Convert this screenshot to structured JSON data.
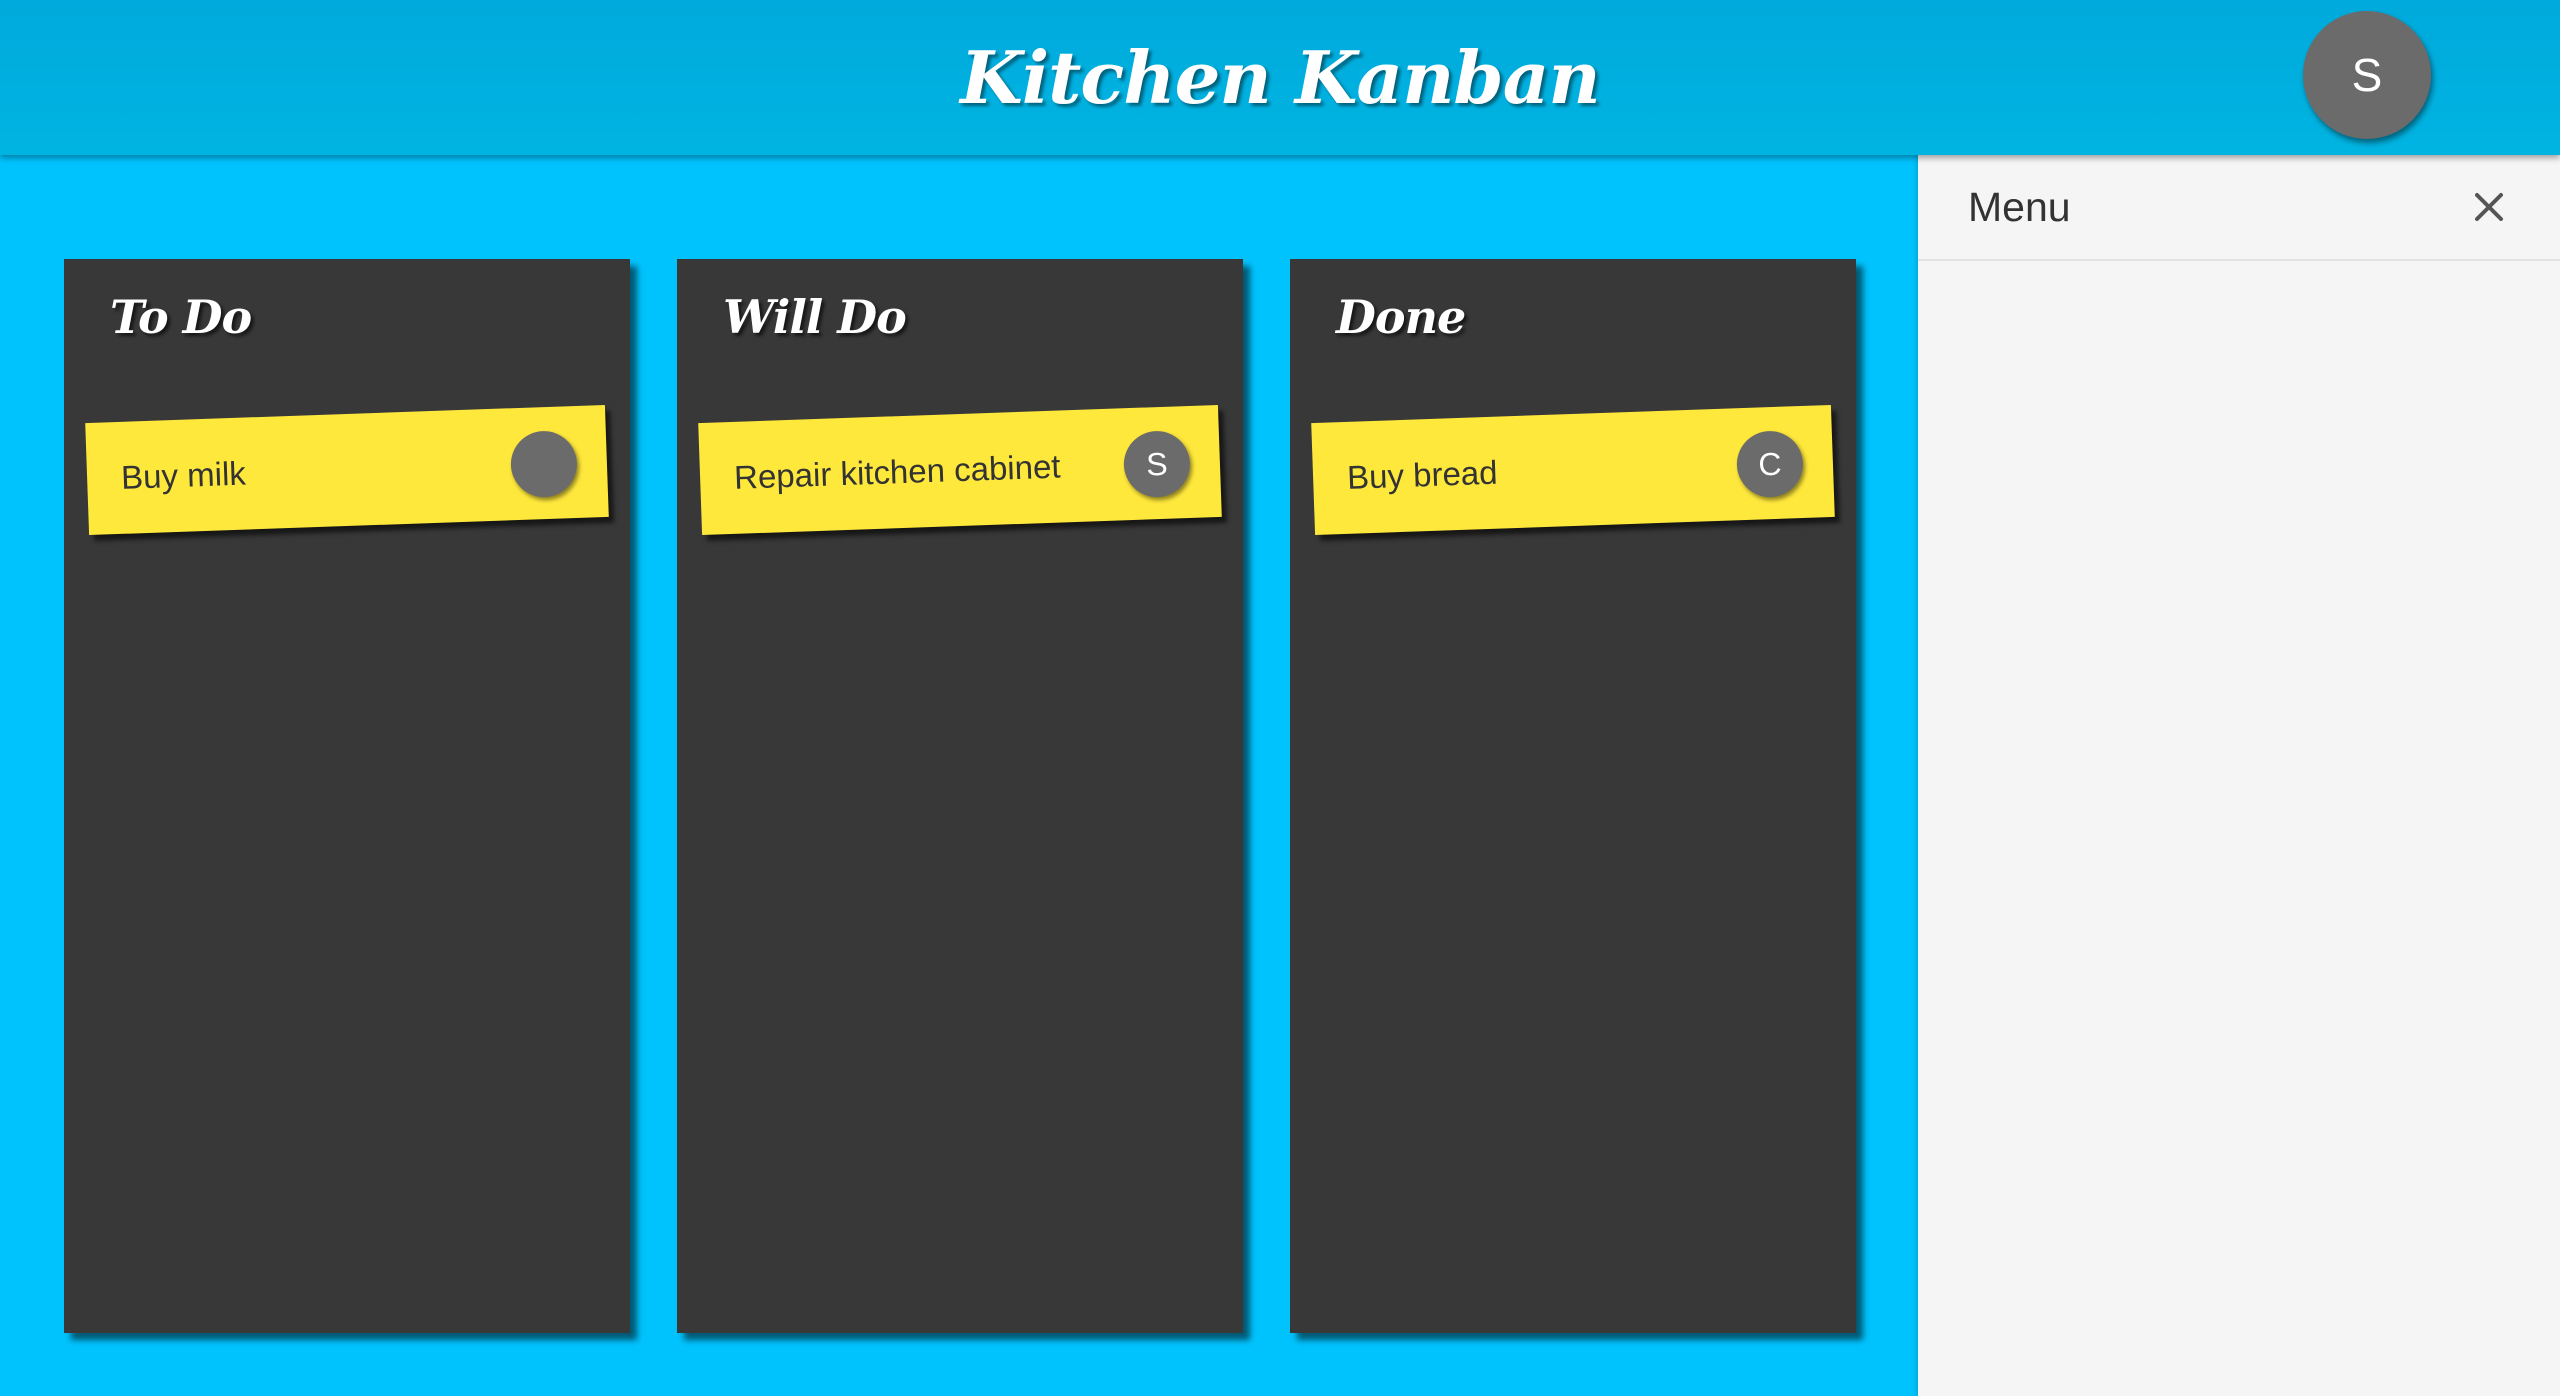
{
  "header": {
    "title": "Kitchen Kanban",
    "user_initial": "S"
  },
  "columns": [
    {
      "title": "To Do",
      "cards": [
        {
          "text": "Buy milk",
          "assignee": ""
        }
      ]
    },
    {
      "title": "Will Do",
      "cards": [
        {
          "text": "Repair kitchen cabinet",
          "assignee": "S"
        }
      ]
    },
    {
      "title": "Done",
      "cards": [
        {
          "text": "Buy bread",
          "assignee": "C"
        }
      ]
    }
  ],
  "menu": {
    "title": "Menu",
    "close_icon": "close-icon"
  },
  "colors": {
    "header": "#00b4e2",
    "board_background": "#00c3fe",
    "column": "#383838",
    "card": "#ffe83c",
    "avatar": "#6b6b6b",
    "menu_background": "#f5f5f5"
  }
}
